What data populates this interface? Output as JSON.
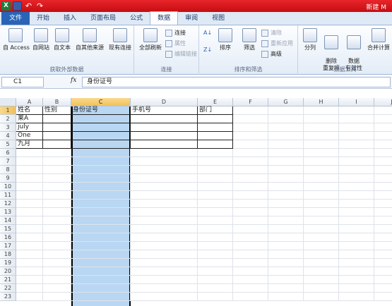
{
  "titlebar": {
    "qa_label": "Excel",
    "title": "新建 M"
  },
  "tabs": [
    "文件",
    "开始",
    "插入",
    "页面布局",
    "公式",
    "数据",
    "审阅",
    "视图"
  ],
  "active_tab": "数据",
  "ribbon": {
    "get_external": {
      "label": "获取外部数据",
      "buttons": [
        "自 Access",
        "自网站",
        "自文本",
        "自其他来源",
        "现有连接"
      ]
    },
    "connections": {
      "label": "连接",
      "refresh": "全部刷新",
      "items": [
        "连接",
        "属性",
        "编辑链接"
      ]
    },
    "sort_filter": {
      "label": "排序和筛选",
      "sort": "排序",
      "filter": "筛选",
      "items": [
        "清除",
        "重新应用",
        "高级"
      ]
    },
    "data_tools": {
      "label": "数据工具",
      "buttons": [
        "分列",
        "删除\n重复项",
        "数据\n有效性",
        "合并计算"
      ]
    }
  },
  "formula_bar": {
    "name_box": "C1",
    "fx": "fx",
    "value": "身份证号"
  },
  "columns": [
    "A",
    "B",
    "C",
    "D",
    "E",
    "F",
    "G",
    "H",
    "I",
    "J"
  ],
  "selected_column": "C",
  "rows": [
    "1",
    "2",
    "3",
    "4",
    "5",
    "6",
    "7",
    "8",
    "9",
    "10",
    "11",
    "12",
    "13",
    "14",
    "15",
    "16",
    "17",
    "18",
    "19",
    "20",
    "21",
    "22",
    "23"
  ],
  "cells": {
    "A1": "姓名",
    "B1": "性别",
    "C1": "身份证号",
    "D1": "手机号",
    "E1": "部门",
    "A2": "莱A",
    "A3": "july",
    "A4": "One",
    "A5": "九月"
  }
}
